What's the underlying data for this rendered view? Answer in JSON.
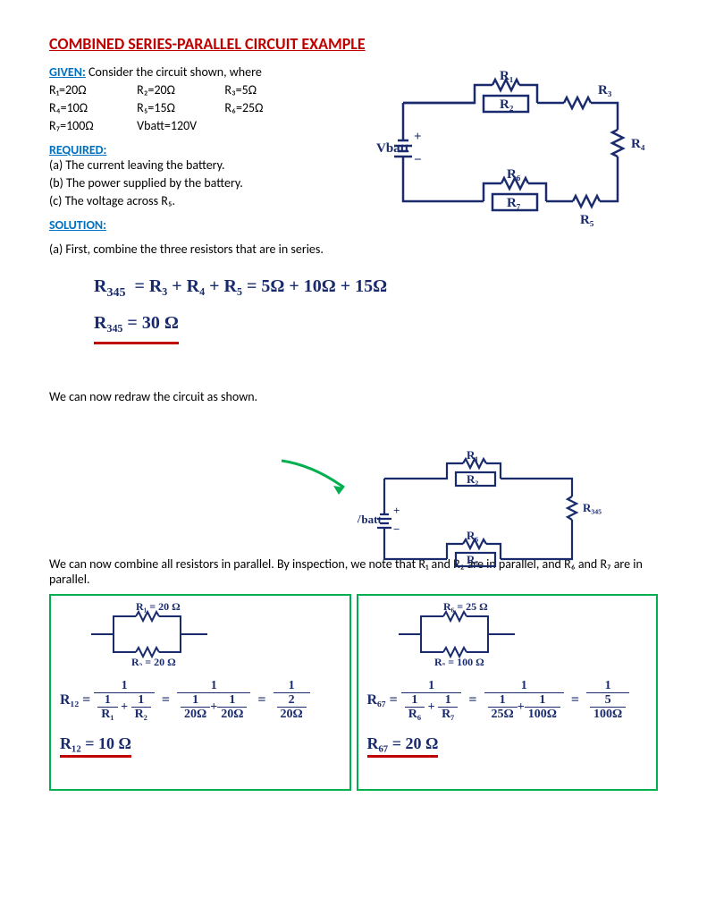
{
  "title": "COMBINED SERIES-PARALLEL CIRCUIT EXAMPLE",
  "given_label": "GIVEN:",
  "given_text": " Consider the circuit shown, where",
  "resistors": {
    "r1": "R₁=20Ω",
    "r2": "R₂=20Ω",
    "r3": "R₃=5Ω",
    "r4": "R₄=10Ω",
    "r5": "R₅=15Ω",
    "r6": "R₆=25Ω",
    "r7": "R₇=100Ω",
    "vb": "Vbatt=120V"
  },
  "required_label": "REQUIRED:",
  "req_a": "(a) The current leaving the battery.",
  "req_b": "(b) The power supplied by the battery.",
  "req_c": "(c) The voltage across R₅.",
  "solution_label": "SOLUTION:",
  "sol_a_intro": "(a) First, combine the three resistors that are in series.",
  "eq1_lhs": "R",
  "eq1_sub": "345",
  "eq1_mid": "=  R₃ + R₄ + R₅  =  5Ω + 10Ω + 15Ω",
  "eq1_ans": "R₃₄₅ =  30 Ω",
  "redraw_text": "We can now redraw the circuit as shown.",
  "para_text": "We can now combine all resistors in parallel. By inspection, we note that R₁ and R₂ are in parallel, and R₆ and R₇ are in parallel.",
  "circuit_main": {
    "vbatt": "Vbatt",
    "r1": "R₁",
    "r2": "R₂",
    "r3": "R₃",
    "r4": "R₄",
    "r5": "R₅",
    "r6": "R₆",
    "r7": "R₇"
  },
  "circuit_redraw": {
    "vbatt": "Vbatt",
    "r1": "R₁",
    "r2": "R₂",
    "r345": "R₃₄₅",
    "r6": "R₆",
    "r7": "R₇"
  },
  "box1": {
    "top": "R₁ = 20 Ω",
    "bot": "R₂ = 20 Ω",
    "eq_lhs": "R₁₂ =",
    "d1a": "1",
    "d1b": "R₁",
    "d2a": "1",
    "d2b": "R₂",
    "m1a": "1",
    "m1b": "20Ω",
    "m2a": "1",
    "m2b": "20Ω",
    "r1a": "1",
    "r1b": "2",
    "r1c": "20Ω",
    "ans": "R₁₂ =  10 Ω"
  },
  "box2": {
    "top": "R₆ = 25 Ω",
    "bot": "R₇ = 100 Ω",
    "eq_lhs": "R₆₇ =",
    "d1a": "1",
    "d1b": "R₆",
    "d2a": "1",
    "d2b": "R₇",
    "m1a": "1",
    "m1b": "25Ω",
    "m2a": "1",
    "m2b": "100Ω",
    "r1a": "1",
    "r1b": "5",
    "r1c": "100Ω",
    "ans": "R₆₇ =  20 Ω"
  }
}
